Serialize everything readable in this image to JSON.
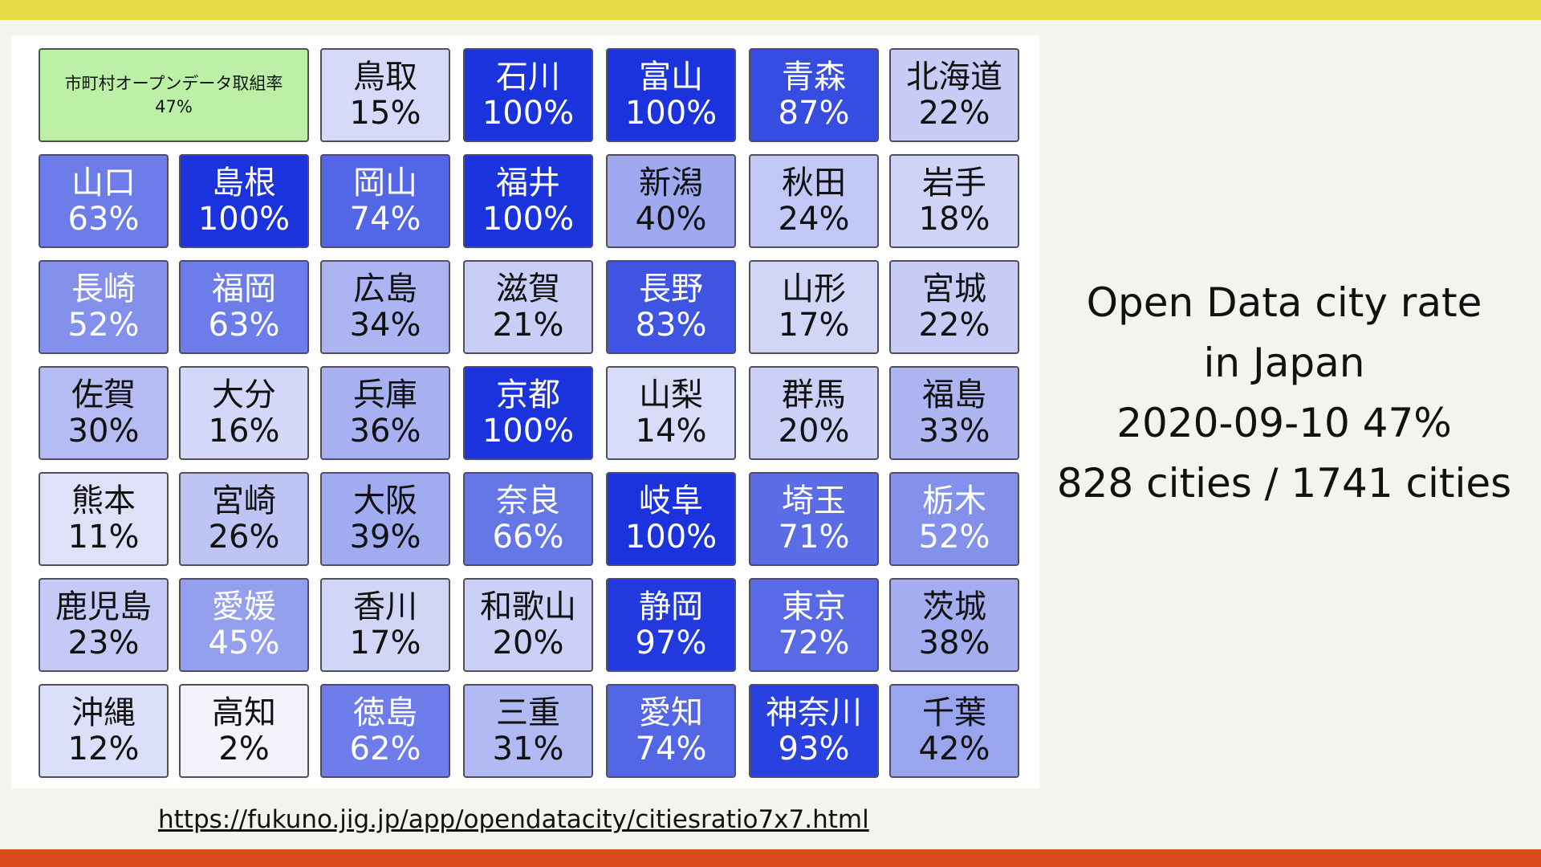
{
  "title": {
    "lines": [
      "Open Data city rate",
      "in Japan",
      "2020-09-10 47%",
      "828 cities / 1741 cities"
    ]
  },
  "url": "https://fukuno.jig.jp/app/opendatacity/citiesratio7x7.html",
  "colors": {
    "summary": "#bdf0a7",
    "low": "#f7f7fd",
    "high": "#1a33dc",
    "border": "#50505a",
    "top_bar": "#e8dd47",
    "bottom_bar": "#d8491e",
    "background": "#f3f4ee"
  },
  "chart_data": {
    "type": "heatmap",
    "summary": {
      "label": "市町村オープンデータ取組率",
      "value": "47%"
    },
    "rows": [
      [
        {
          "name": "鳥取",
          "value": 15
        },
        {
          "name": "石川",
          "value": 100
        },
        {
          "name": "富山",
          "value": 100
        },
        {
          "name": "青森",
          "value": 87
        },
        {
          "name": "北海道",
          "value": 22
        }
      ],
      [
        {
          "name": "山口",
          "value": 63
        },
        {
          "name": "島根",
          "value": 100
        },
        {
          "name": "岡山",
          "value": 74
        },
        {
          "name": "福井",
          "value": 100
        },
        {
          "name": "新潟",
          "value": 40
        },
        {
          "name": "秋田",
          "value": 24
        },
        {
          "name": "岩手",
          "value": 18
        }
      ],
      [
        {
          "name": "長崎",
          "value": 52
        },
        {
          "name": "福岡",
          "value": 63
        },
        {
          "name": "広島",
          "value": 34
        },
        {
          "name": "滋賀",
          "value": 21
        },
        {
          "name": "長野",
          "value": 83
        },
        {
          "name": "山形",
          "value": 17
        },
        {
          "name": "宮城",
          "value": 22
        }
      ],
      [
        {
          "name": "佐賀",
          "value": 30
        },
        {
          "name": "大分",
          "value": 16
        },
        {
          "name": "兵庫",
          "value": 36
        },
        {
          "name": "京都",
          "value": 100
        },
        {
          "name": "山梨",
          "value": 14
        },
        {
          "name": "群馬",
          "value": 20
        },
        {
          "name": "福島",
          "value": 33
        }
      ],
      [
        {
          "name": "熊本",
          "value": 11
        },
        {
          "name": "宮崎",
          "value": 26
        },
        {
          "name": "大阪",
          "value": 39
        },
        {
          "name": "奈良",
          "value": 66
        },
        {
          "name": "岐阜",
          "value": 100
        },
        {
          "name": "埼玉",
          "value": 71
        },
        {
          "name": "栃木",
          "value": 52
        }
      ],
      [
        {
          "name": "鹿児島",
          "value": 23
        },
        {
          "name": "愛媛",
          "value": 45
        },
        {
          "name": "香川",
          "value": 17
        },
        {
          "name": "和歌山",
          "value": 20
        },
        {
          "name": "静岡",
          "value": 97
        },
        {
          "name": "東京",
          "value": 72
        },
        {
          "name": "茨城",
          "value": 38
        }
      ],
      [
        {
          "name": "沖縄",
          "value": 12
        },
        {
          "name": "高知",
          "value": 2
        },
        {
          "name": "徳島",
          "value": 62
        },
        {
          "name": "三重",
          "value": 31
        },
        {
          "name": "愛知",
          "value": 74
        },
        {
          "name": "神奈川",
          "value": 93
        },
        {
          "name": "千葉",
          "value": 42
        }
      ]
    ],
    "unit": "%"
  }
}
